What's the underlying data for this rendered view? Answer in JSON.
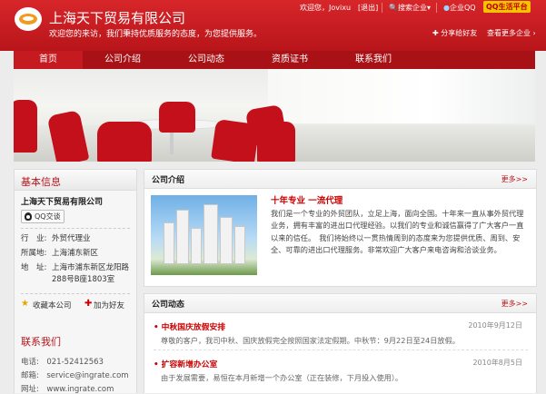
{
  "header": {
    "company_name": "上海天下贸易有限公司",
    "slogan": "欢迎您的来访，我们秉持优质服务的态度，为您提供服务。",
    "welcome": "欢迎您，Jovixu",
    "logout": "[退出]",
    "search": "搜索企业",
    "qq_link": "企业QQ",
    "qq_platform": "QQ生活平台",
    "share": "分享给好友",
    "more_business": "查看更多企业"
  },
  "nav": {
    "items": [
      "首页",
      "公司介绍",
      "公司动态",
      "资质证书",
      "联系我们"
    ]
  },
  "sidebar": {
    "basic_title": "基本信息",
    "company": "上海天下贸易有限公司",
    "qq_chat": "QQ交谈",
    "industry_key": "行　业:",
    "industry_val": "外贸代理业",
    "location_key": "所属地:",
    "location_val": "上海浦东新区",
    "address_key": "地　址:",
    "address_val": "上海市浦东新区龙阳路288号B座1803室",
    "favorite": "收藏本公司",
    "add_friend": "加为好友",
    "contact_title": "联系我们",
    "phone": "电话:　021-52412563",
    "email": "邮箱:　service@ingrate.com",
    "website": "网址:　www.ingrate.com"
  },
  "intro": {
    "title": "公司介绍",
    "more": "更多>>",
    "heading": "十年专业 一流代理",
    "text": "我们是一个专业的外贸团队，立足上海，面向全国。十年来一直从事外贸代理业务，拥有丰富的进出口代理经验。以我们的专业和诚信赢得了广大客户一直以来的信任。　我们将始终以一贯热情周到的态度来为您提供优质、周到、安全、可靠的进出口代理服务。非常欢迎广大客户来电咨询和洽谈业务。"
  },
  "news": {
    "title": "公司动态",
    "more": "更多>>",
    "items": [
      {
        "title": "• 中秋国庆放假安排",
        "date": "2010年9月12日",
        "summary": "尊敬的客户，我司中秋、国庆放假完全按照国家法定假期。中秋节：9月22日至24日放假。"
      },
      {
        "title": "• 扩容新增办公室",
        "date": "2010年8月5日",
        "summary": "由于发展需要，易恒在本月新增一个办公室（正在装修，下月投入使用）。"
      }
    ]
  },
  "colors": {
    "brand_red": "#c51a1f",
    "nav_red": "#a81216",
    "accent_yellow": "#f6c300"
  }
}
